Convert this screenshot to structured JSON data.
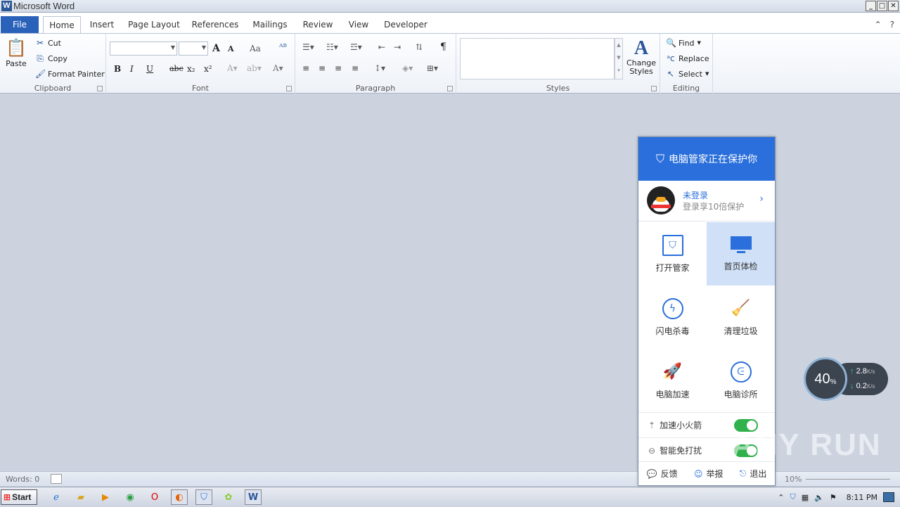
{
  "window": {
    "title": "Microsoft Word",
    "app_icon": "W"
  },
  "tabs": {
    "file": "File",
    "items": [
      "Home",
      "Insert",
      "Page Layout",
      "References",
      "Mailings",
      "Review",
      "View",
      "Developer"
    ]
  },
  "clipboard": {
    "paste": "Paste",
    "cut": "Cut",
    "copy": "Copy",
    "format_painter": "Format Painter",
    "label": "Clipboard"
  },
  "font": {
    "label": "Font",
    "bold": "B",
    "italic": "I",
    "underline": "U",
    "strike": "abc",
    "sub": "x₂",
    "sup": "x²",
    "grow": "A",
    "shrink": "A",
    "case": "Aa"
  },
  "paragraph": {
    "label": "Paragraph",
    "pilcrow": "¶"
  },
  "styles": {
    "label": "Styles",
    "change_styles": "Change Styles"
  },
  "editing": {
    "label": "Editing",
    "find": "Find",
    "replace": "Replace",
    "select": "Select"
  },
  "status": {
    "words": "Words: 0",
    "zoom": "10%"
  },
  "taskbar": {
    "start": "Start",
    "clock": "8:11 PM"
  },
  "panel": {
    "header": "电脑管家正在保护你",
    "user_name": "未登录",
    "user_sub": "登录享10倍保护",
    "items": [
      {
        "label": "打开管家",
        "icon": "shield-icon"
      },
      {
        "label": "首页体检",
        "icon": "monitor-icon"
      },
      {
        "label": "闪电杀毒",
        "icon": "lightning-icon"
      },
      {
        "label": "清理垃圾",
        "icon": "broom-icon"
      },
      {
        "label": "电脑加速",
        "icon": "rocket-icon"
      },
      {
        "label": "电脑诊所",
        "icon": "stethoscope-icon"
      }
    ],
    "toggle1": "加速小火箭",
    "toggle2": "智能免打扰",
    "feedback": "反馈",
    "report": "举报",
    "exit": "退出"
  },
  "speed": {
    "percent": "40",
    "unit": "%",
    "up": "2.8",
    "down": "0.2",
    "rate_unit": "K/s"
  },
  "watermark": "ANY RUN",
  "colors": {
    "accent": "#2a6fdb",
    "file_tab": "#2a62b9",
    "toggle_on": "#2fb14b"
  }
}
